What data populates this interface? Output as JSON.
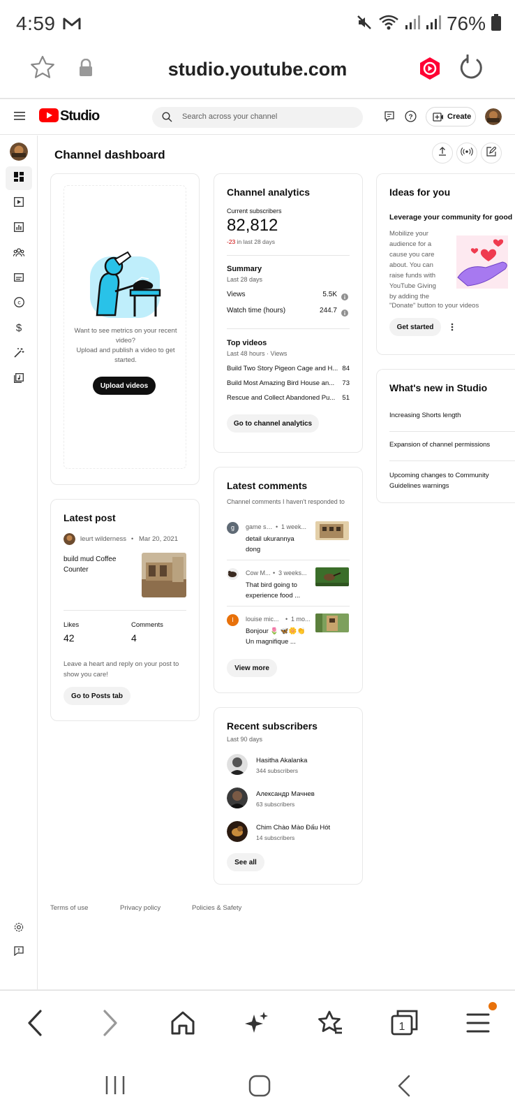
{
  "status_bar": {
    "time": "4:59",
    "battery": "76%"
  },
  "browser": {
    "url": "studio.youtube.com"
  },
  "studio": {
    "logo_text": "Studio",
    "search_placeholder": "Search across your channel",
    "create_label": "Create"
  },
  "page_title": "Channel dashboard",
  "upload_card": {
    "line1": "Want to see metrics on your recent video?",
    "line2": "Upload and publish a video to get started.",
    "button": "Upload videos"
  },
  "analytics": {
    "title": "Channel analytics",
    "subs_label": "Current subscribers",
    "subs_value": "82,812",
    "subs_change": "-23",
    "subs_change_suffix": " in last 28 days",
    "summary_title": "Summary",
    "summary_period": "Last 28 days",
    "rows": [
      {
        "label": "Views",
        "value": "5.5K"
      },
      {
        "label": "Watch time (hours)",
        "value": "244.7"
      }
    ],
    "top_title": "Top videos",
    "top_period": "Last 48 hours · Views",
    "top_videos": [
      {
        "title": "Build Two Story Pigeon Cage and H...",
        "views": "84"
      },
      {
        "title": "Build Most Amazing Bird House an...",
        "views": "73"
      },
      {
        "title": "Rescue and Collect Abandoned Pu...",
        "views": "51"
      }
    ],
    "button": "Go to channel analytics"
  },
  "ideas": {
    "title": "Ideas for you",
    "subtitle": "Leverage your community for good",
    "body_lines": [
      "Mobilize your",
      "audience for a",
      "cause you care",
      "about. You can",
      "raise funds with",
      "YouTube Giving",
      "by adding the"
    ],
    "body_last": "\"Donate\" button to your videos",
    "button": "Get started"
  },
  "whats_new": {
    "title": "What's new in Studio",
    "items": [
      "Increasing Shorts length",
      "Expansion of channel permissions",
      "Upcoming changes to Community Guidelines warnings"
    ]
  },
  "latest_post": {
    "title": "Latest post",
    "author": "leurt wilderness",
    "date": "Mar 20, 2021",
    "text": "build mud Coffee Counter",
    "likes_label": "Likes",
    "likes": "42",
    "comments_label": "Comments",
    "comments": "4",
    "note": "Leave a heart and reply on your post to show you care!",
    "button": "Go to Posts tab"
  },
  "latest_comments": {
    "title": "Latest comments",
    "subtitle": "Channel comments I haven't responded to",
    "items": [
      {
        "initial": "g",
        "author": "game sa...",
        "time": "1 week...",
        "line1": "detail ukurannya",
        "line2": "dong",
        "avatar_color": "#5f6a75"
      },
      {
        "initial": "",
        "author": "Cow M...",
        "time": "3 weeks...",
        "line1": "That bird going to",
        "line2": "experience food ...",
        "avatar_color": "#3a2a20"
      },
      {
        "initial": "l",
        "author": "louise mic...",
        "time": "1 mo...",
        "line1": "Bonjour 🌷 🦋🌼👏",
        "line2": "Un magnifique ...",
        "avatar_color": "#e8710a"
      }
    ],
    "button": "View more"
  },
  "recent_subs": {
    "title": "Recent subscribers",
    "period": "Last 90 days",
    "items": [
      {
        "name": "Hasitha Akalanka",
        "subs": "344 subscribers"
      },
      {
        "name": "Александр Мачнев",
        "subs": "63 subscribers"
      },
      {
        "name": "Chim Chào Mào Đấu Hót",
        "subs": "14 subscribers"
      }
    ],
    "button": "See all"
  },
  "footer": {
    "links": [
      "Terms of use",
      "Privacy policy",
      "Policies & Safety"
    ]
  },
  "colors": {
    "youtube_red": "#ff0000",
    "negative_red": "#cc0000",
    "orange_dot": "#e8710a"
  }
}
